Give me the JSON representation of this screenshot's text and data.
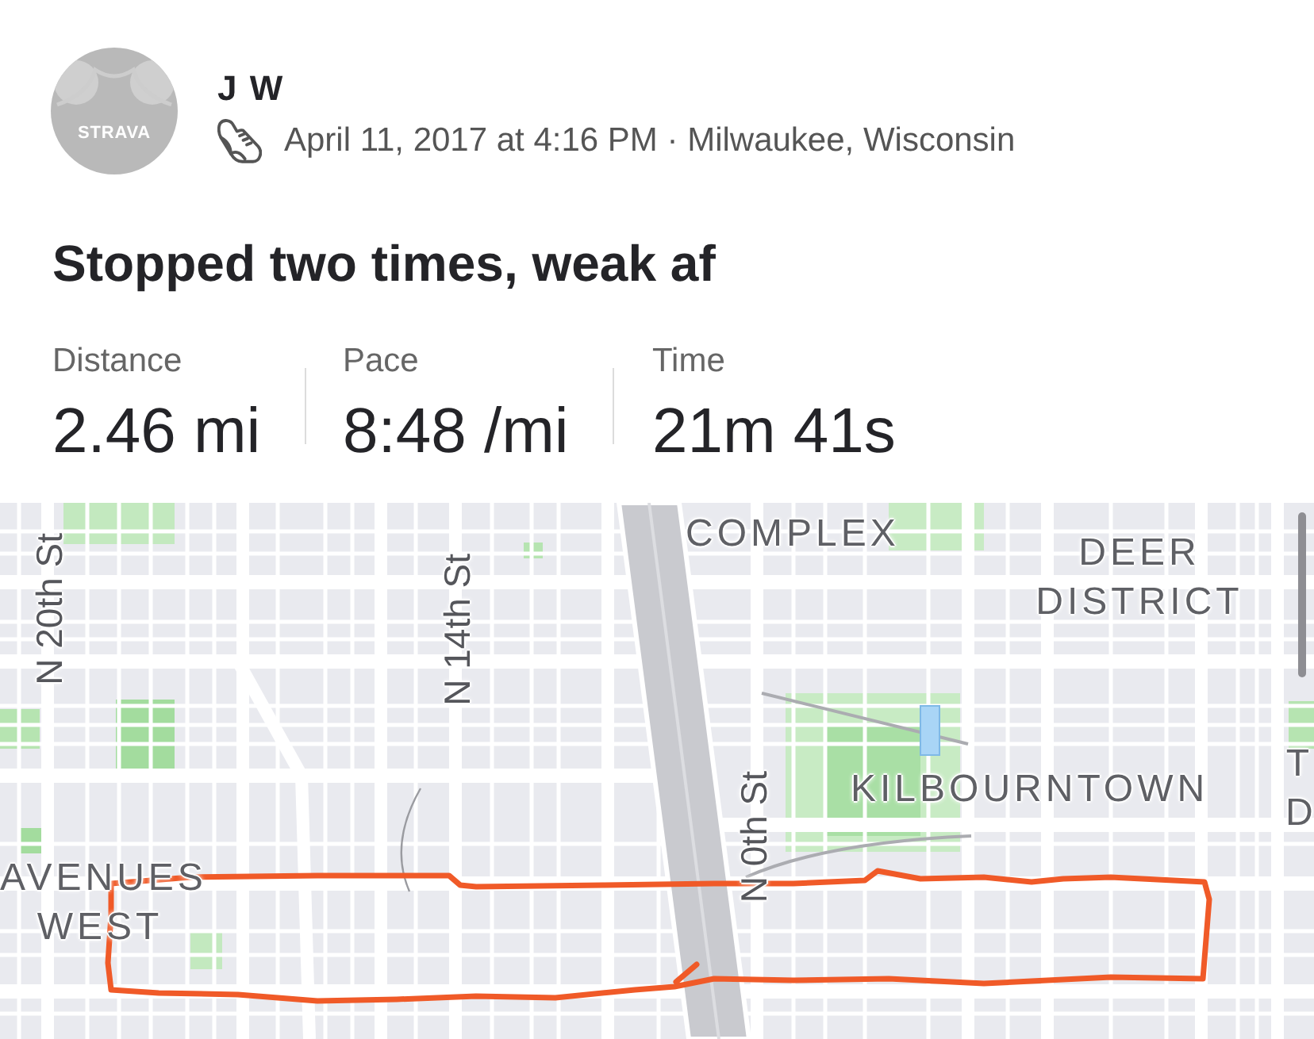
{
  "athlete": {
    "avatar_text": "STRAVA",
    "name": "J W"
  },
  "activity": {
    "kind": "run",
    "meta": "April 11, 2017 at 4:16 PM · Milwaukee, Wisconsin",
    "title": "Stopped two times, weak af"
  },
  "stats": [
    {
      "label": "Distance",
      "value": "2.46 mi"
    },
    {
      "label": "Pace",
      "value": "8:48 /mi"
    },
    {
      "label": "Time",
      "value": "21m 41s"
    }
  ],
  "map": {
    "labels": [
      {
        "kind": "area",
        "text": "COMPLEX"
      },
      {
        "kind": "area",
        "text": "DEER DISTRICT"
      },
      {
        "kind": "area",
        "text": "KILBOURNTOWN"
      },
      {
        "kind": "area",
        "text": "AVENUES WEST"
      },
      {
        "kind": "area",
        "text": "T D"
      },
      {
        "kind": "street",
        "text": "N 20th St"
      },
      {
        "kind": "street",
        "text": "N 14th St"
      },
      {
        "kind": "street",
        "text": "N 0th St"
      }
    ]
  }
}
